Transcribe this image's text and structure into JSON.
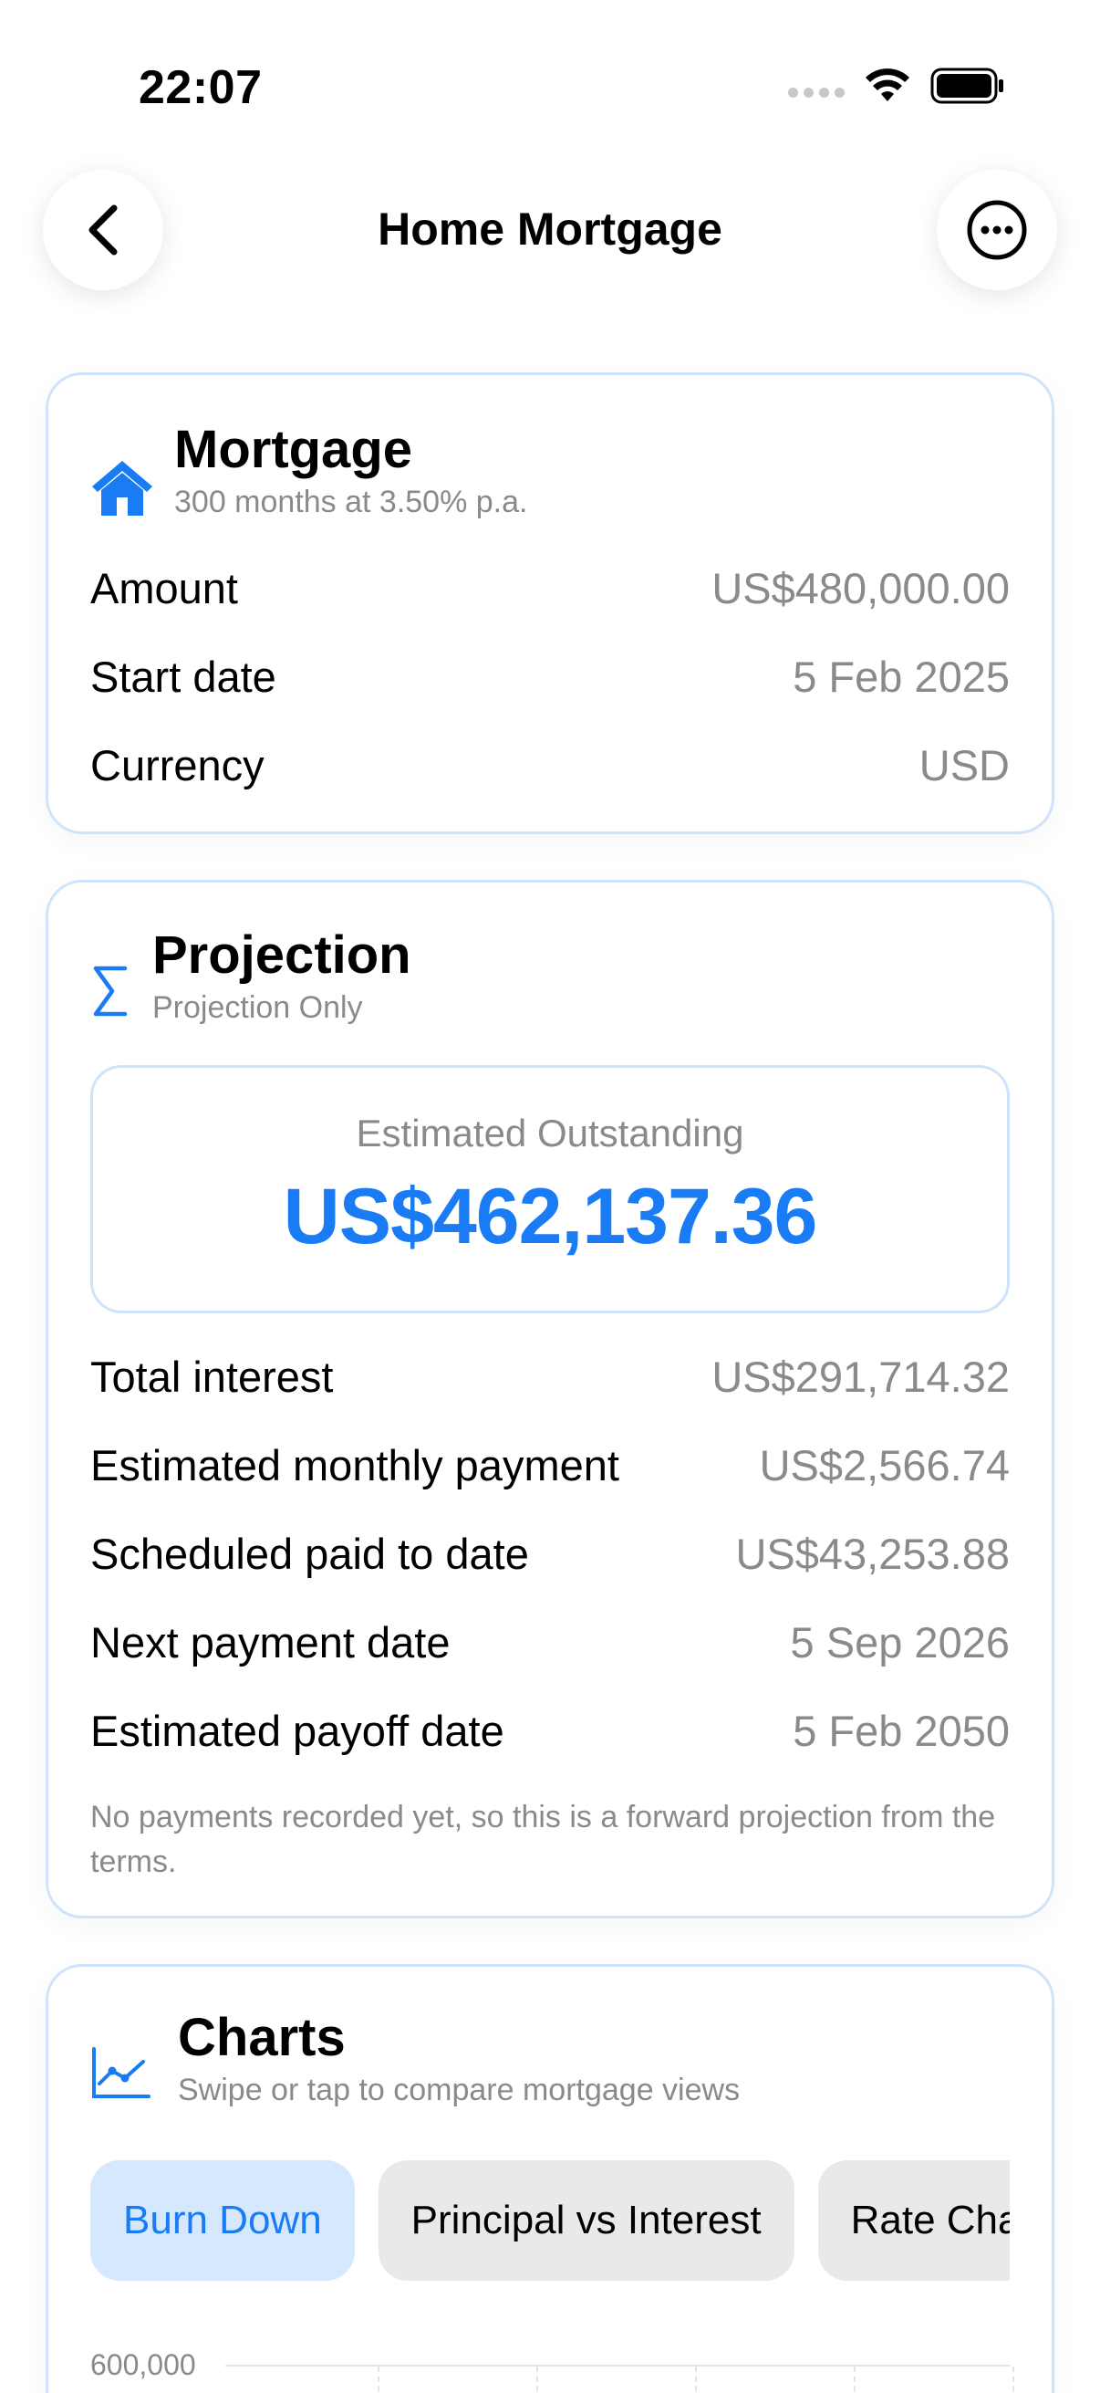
{
  "status": {
    "time": "22:07"
  },
  "nav": {
    "title": "Home Mortgage"
  },
  "mortgage": {
    "title": "Mortgage",
    "subtitle": "300 months at 3.50% p.a.",
    "rows": [
      {
        "label": "Amount",
        "value": "US$480,000.00"
      },
      {
        "label": "Start date",
        "value": "5 Feb 2025"
      },
      {
        "label": "Currency",
        "value": "USD"
      }
    ]
  },
  "projection": {
    "title": "Projection",
    "subtitle": "Projection Only",
    "estimate_label": "Estimated Outstanding",
    "estimate_value": "US$462,137.36",
    "rows": [
      {
        "label": "Total interest",
        "value": "US$291,714.32"
      },
      {
        "label": "Estimated monthly payment",
        "value": "US$2,566.74"
      },
      {
        "label": "Scheduled paid to date",
        "value": "US$43,253.88"
      },
      {
        "label": "Next payment date",
        "value": "5 Sep 2026"
      },
      {
        "label": "Estimated payoff date",
        "value": "5 Feb 2050"
      }
    ],
    "note": "No payments recorded yet, so this is a forward projection from the terms."
  },
  "charts": {
    "title": "Charts",
    "subtitle": "Swipe or tap to compare mortgage views",
    "tabs": [
      {
        "label": "Burn Down",
        "active": true
      },
      {
        "label": "Principal vs Interest",
        "active": false
      },
      {
        "label": "Rate Changes",
        "active": false
      }
    ],
    "y_axis_top": "600,000"
  },
  "colors": {
    "accent": "#1a7cf5",
    "card_border": "#cfe3fb",
    "secondary_text": "#8a8a8e"
  }
}
